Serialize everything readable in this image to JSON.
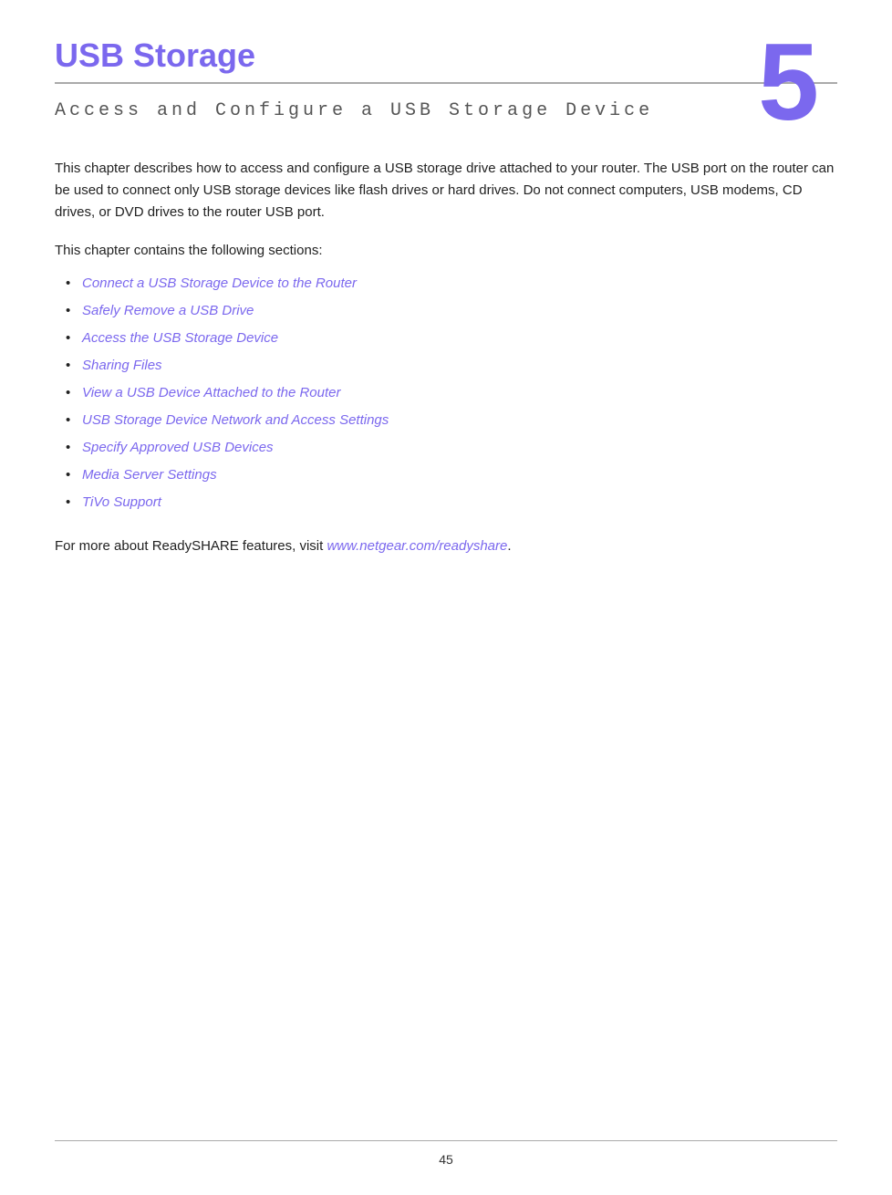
{
  "header": {
    "chapter_title": "USB Storage",
    "chapter_number": "5",
    "chapter_subtitle": "Access and Configure a USB Storage Device"
  },
  "intro": {
    "paragraph1": "This chapter describes how to access and configure a USB storage drive attached to your router. The USB port on the router can be used to connect only USB storage devices like flash drives or hard drives. Do not connect computers, USB modems, CD drives, or DVD drives to the router USB port.",
    "paragraph2": "This chapter contains the following sections:"
  },
  "toc": {
    "items": [
      {
        "label": "Connect a USB Storage Device to the Router",
        "href": "#"
      },
      {
        "label": "Safely Remove a USB Drive",
        "href": "#"
      },
      {
        "label": "Access the USB Storage Device",
        "href": "#"
      },
      {
        "label": "Sharing Files",
        "href": "#"
      },
      {
        "label": "View a USB Device Attached to the Router",
        "href": "#"
      },
      {
        "label": "USB Storage Device Network and Access Settings",
        "href": "#"
      },
      {
        "label": "Specify Approved USB Devices",
        "href": "#"
      },
      {
        "label": "Media Server Settings",
        "href": "#"
      },
      {
        "label": "TiVo Support",
        "href": "#"
      }
    ]
  },
  "footer_text": {
    "before_link": "For more about ReadySHARE features, visit ",
    "link_text": "www.netgear.com/readyshare",
    "after_link": "."
  },
  "page_number": "45"
}
